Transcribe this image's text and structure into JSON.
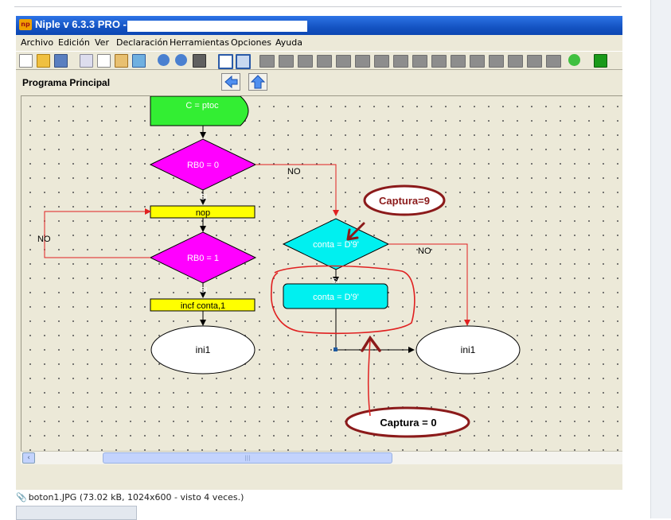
{
  "window": {
    "title": "Niple v 6.3.3 PRO -",
    "logo": "np"
  },
  "menu": [
    "Archivo",
    "Edición",
    "Ver",
    "Declaración",
    "Herramientas",
    "Opciones",
    "Ayuda"
  ],
  "toolbar": {
    "icons": [
      "new-file-icon",
      "open-folder-icon",
      "save-icon",
      "cut-icon",
      "copy-icon",
      "paste-icon",
      "select-icon",
      "undo-icon",
      "redo-icon",
      "binoculars-icon",
      "window-icon",
      "grid-icon",
      "compile-icon",
      "run-icon"
    ]
  },
  "subbar": {
    "title": "Programa Principal",
    "back_icon": "left-arrow-icon",
    "up_icon": "up-arrow-icon"
  },
  "flowchart": {
    "colors": {
      "green": "#33ee33",
      "magenta": "#ff00ff",
      "yellow": "#ffff00",
      "cyan": "#00f0f0",
      "white": "#ffffff",
      "line": "#e02020",
      "annotation": "#8b1a1a"
    },
    "blocks": {
      "start": "C = ptoc",
      "decision1": "RB0 = 0",
      "action_nop": "nop",
      "decision2": "RB0 = 1",
      "action_inc": "incf conta,1",
      "end_left": "ini1",
      "decision3": "conta = D'9'",
      "action_set": "conta = D'9'",
      "end_right": "ini1"
    },
    "labels": {
      "no1": "NO",
      "si1": "SI",
      "no2": "NO",
      "si2": "SI",
      "no3": "NO",
      "si3": "SI"
    },
    "annotations": {
      "captura_top": "Captura=9",
      "captura_bottom": "Captura = 0"
    }
  },
  "scrollbar": {
    "left_arrow": "‹",
    "grip": "|||"
  },
  "attachment": {
    "icon": "paperclip-icon",
    "text": "boton1.JPG (73.02 kB, 1024x600 - visto 4 veces.)"
  }
}
